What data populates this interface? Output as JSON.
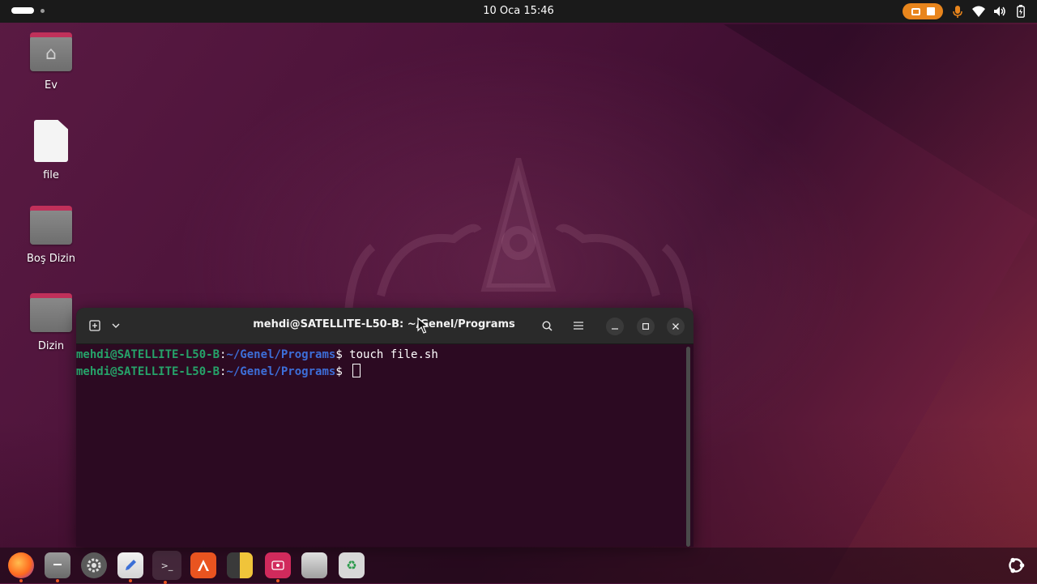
{
  "topbar": {
    "clock": "10 Oca  15:46"
  },
  "desktop": {
    "icons": [
      {
        "label": "Ev"
      },
      {
        "label": "file"
      },
      {
        "label": "Boş Dizin"
      },
      {
        "label": "Dizin"
      }
    ]
  },
  "terminal": {
    "title": "mehdi@SATELLITE-L50-B: ~/Genel/Programs",
    "lines": [
      {
        "user": "mehdi@SATELLITE-L50-B",
        "colon": ":",
        "path": "~/Genel/Programs",
        "prompt": "$ ",
        "command": "touch file.sh"
      },
      {
        "user": "mehdi@SATELLITE-L50-B",
        "colon": ":",
        "path": "~/Genel/Programs",
        "prompt": "$ ",
        "command": ""
      }
    ]
  },
  "colors": {
    "accent": "#e95420",
    "prompt_user": "#26a269",
    "prompt_path": "#3d6ed8",
    "terminal_bg": "#2c0a22"
  },
  "icons": {
    "new_tab": "new-tab-icon",
    "tab_menu": "chevron-down-icon",
    "search": "search-icon",
    "menu": "hamburger-icon",
    "minimize": "minimize-icon",
    "maximize": "maximize-icon",
    "close": "close-icon"
  }
}
